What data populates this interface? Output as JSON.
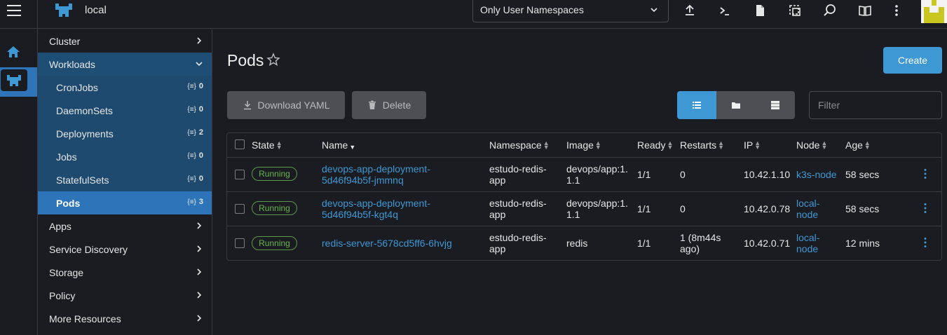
{
  "topbar": {
    "cluster_name": "local",
    "namespace_filter": "Only User Namespaces",
    "icons": [
      "upload-icon",
      "terminal-icon",
      "file-icon",
      "copy-kubeconfig-icon",
      "search-icon",
      "book-icon",
      "more-vertical-icon"
    ]
  },
  "nav": {
    "cluster": "Cluster",
    "workloads": "Workloads",
    "children": [
      {
        "label": "CronJobs",
        "count": "0"
      },
      {
        "label": "DaemonSets",
        "count": "0"
      },
      {
        "label": "Deployments",
        "count": "2"
      },
      {
        "label": "Jobs",
        "count": "0"
      },
      {
        "label": "StatefulSets",
        "count": "0"
      },
      {
        "label": "Pods",
        "count": "3"
      }
    ],
    "apps": "Apps",
    "service_discovery": "Service Discovery",
    "storage": "Storage",
    "policy": "Policy",
    "more_resources": "More Resources"
  },
  "main": {
    "title": "Pods",
    "create_label": "Create",
    "download_yaml_label": "Download YAML",
    "delete_label": "Delete",
    "filter_placeholder": "Filter"
  },
  "table": {
    "headers": {
      "state": "State",
      "name": "Name",
      "namespace": "Namespace",
      "image": "Image",
      "ready": "Ready",
      "restarts": "Restarts",
      "ip": "IP",
      "node": "Node",
      "age": "Age"
    },
    "rows": [
      {
        "state": "Running",
        "name_1": "devops-app-deployment-",
        "name_2": "5d46f94b5f-jmmnq",
        "namespace_1": "estudo-redis-",
        "namespace_2": "app",
        "image_1": "devops/app:1.",
        "image_2": "1.1",
        "ready": "1/1",
        "restarts_1": "0",
        "restarts_2": "",
        "ip": "10.42.1.10",
        "node_1": "k3s-node",
        "node_2": "",
        "age": "58 secs"
      },
      {
        "state": "Running",
        "name_1": "devops-app-deployment-",
        "name_2": "5d46f94b5f-kgt4q",
        "namespace_1": "estudo-redis-",
        "namespace_2": "app",
        "image_1": "devops/app:1.",
        "image_2": "1.1",
        "ready": "1/1",
        "restarts_1": "0",
        "restarts_2": "",
        "ip": "10.42.0.78",
        "node_1": "local-",
        "node_2": "node",
        "age": "58 secs"
      },
      {
        "state": "Running",
        "name_1": "redis-server-5678cd5ff6-6hvjg",
        "name_2": "",
        "namespace_1": "estudo-redis-",
        "namespace_2": "app",
        "image_1": "redis",
        "image_2": "",
        "ready": "1/1",
        "restarts_1": "1 (8m44s",
        "restarts_2": "ago)",
        "ip": "10.42.0.71",
        "node_1": "local-",
        "node_2": "node",
        "age": "12 mins"
      }
    ]
  },
  "colors": {
    "accent": "#3d98d3",
    "nav_active": "#2d74b9",
    "nav_open": "#1e4a6f",
    "running": "#66b54e",
    "background": "#1b1c21"
  }
}
